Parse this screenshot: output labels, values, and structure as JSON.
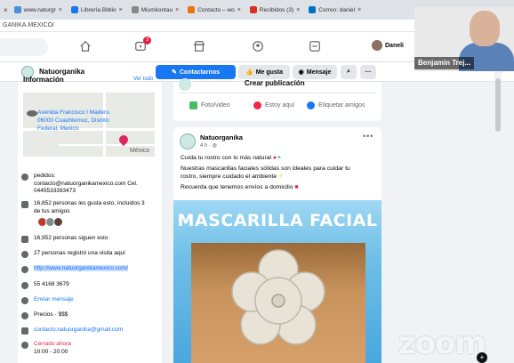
{
  "browser": {
    "tabs": [
      {
        "label": "www.naturgr",
        "color": "#4a90d9"
      },
      {
        "label": "Librería Biblio",
        "color": "#1877f2"
      },
      {
        "label": "Miumkontau",
        "color": "#888888"
      },
      {
        "label": "Contacto – wo",
        "color": "#e9730c"
      },
      {
        "label": "Recibidos (3)",
        "color": "#d93025"
      },
      {
        "label": "Correo: daniel",
        "color": "#0072c6"
      }
    ],
    "url": "GANIKA.MEXICO/"
  },
  "topnav": {
    "notification_count": "3",
    "profile_name": "Daneli"
  },
  "page": {
    "name": "Natuorganika",
    "contact_button": "Contactarnos",
    "like_button": "Me gusta",
    "message_button": "Mensaje"
  },
  "info": {
    "section_title": "Información",
    "see_all": "Ver todo",
    "address": [
      "Avenida Francisco I Madero",
      "06000 Cuauhtémoc, Distrito",
      "Federal, Mexico"
    ],
    "map_label": "México",
    "orders": [
      "pedidos:",
      "contacto@natuorganikamexico.com Cel.",
      "0445533393473"
    ],
    "likes": [
      "16,852 personas les gusta esto, incluidos 3",
      "de tus amigos"
    ],
    "followers": "16,952 personas siguen esto",
    "checkins": "27 personas registró una visita aquí",
    "website": "http://www.natuorganikamexico.com/",
    "phone": "55 4168 3679",
    "send_message": "Enviar mensaje",
    "price": "Precios · $$$",
    "email": "contacto.natuorganika@gmail.com",
    "hours_status": "Cerrado ahora",
    "hours": "10:00 - 20:00"
  },
  "create_post": {
    "title": "Crear publicación",
    "photo_video": "Foto/video",
    "here": "Estoy aquí",
    "tag": "Etiquetar amigos"
  },
  "post": {
    "author": "Natuorganika",
    "meta": "4 h · ",
    "lines": [
      "Cuida tu rostro con lo más natural",
      "Nuestras mascarillas faciales sólidas son ideales para cuidar tu",
      "rostro, siempre cuidado el ambiente",
      "Recuerda que tenemos envíos a domicilio"
    ],
    "image_title": "MASCARILLA FACIAL"
  },
  "overlay": {
    "participant_name": "Benjamin Trej...",
    "watermark": "zoom"
  }
}
